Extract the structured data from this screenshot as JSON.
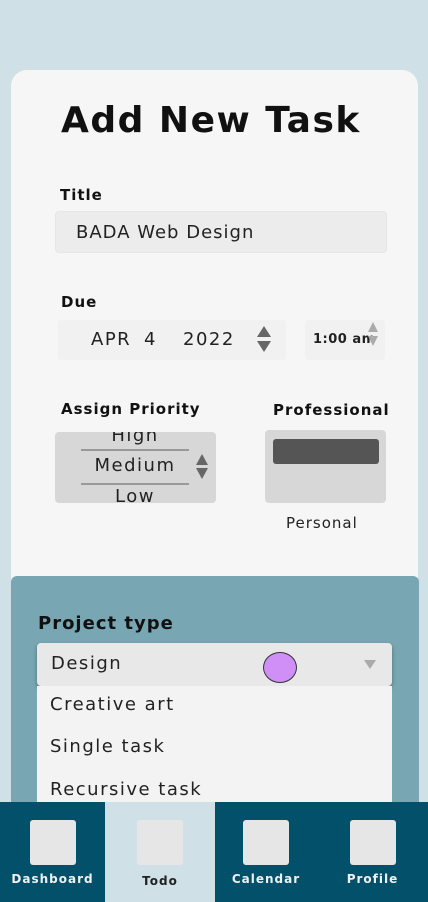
{
  "form": {
    "heading": "Add New Task",
    "title_label": "Title",
    "title_value": "BADA Web Design",
    "due_label": "Due",
    "due_month": "APR",
    "due_day": "4",
    "due_year": "2022",
    "due_time": "1:00 am",
    "priority_label": "Assign Priority",
    "priority_options": [
      "High",
      "Medium",
      "Low"
    ],
    "priority_selected": "Medium",
    "category_on_label": "Professional",
    "category_off_label": "Personal",
    "category_selected": "Professional"
  },
  "project": {
    "label": "Project type",
    "selected": "Design",
    "options": [
      "Creative art",
      "Single task",
      "Recursive task"
    ]
  },
  "nav": {
    "tabs": [
      {
        "label": "Dashboard",
        "icon": "dashboard-icon",
        "active": false
      },
      {
        "label": "Todo",
        "icon": "todo-icon",
        "active": true
      },
      {
        "label": "Calendar",
        "icon": "calendar-icon",
        "active": false
      },
      {
        "label": "Profile",
        "icon": "profile-icon",
        "active": false
      }
    ]
  },
  "colors": {
    "background": "#d0e0e7",
    "card": "#f6f6f6",
    "project_panel": "#78a7b3",
    "tabbar": "#03506b",
    "cursor": "#cf8ff7"
  }
}
